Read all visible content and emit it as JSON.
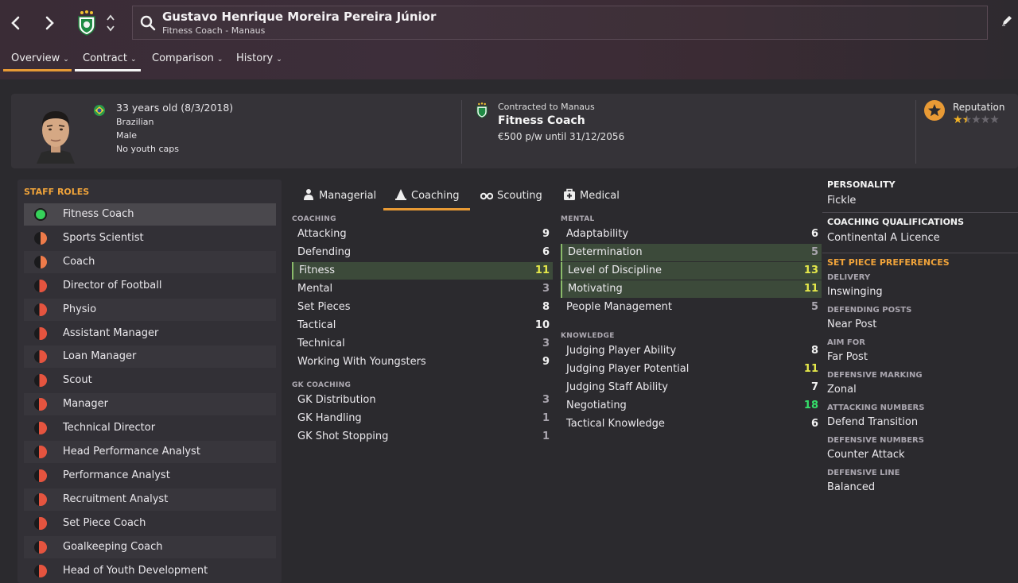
{
  "header": {
    "name": "Gustavo Henrique Moreira Pereira Júnior",
    "subtitle": "Fitness Coach - Manaus"
  },
  "tabs": [
    {
      "label": "Overview",
      "state": "active"
    },
    {
      "label": "Contract",
      "state": "underlined"
    },
    {
      "label": "Comparison",
      "state": ""
    },
    {
      "label": "History",
      "state": ""
    }
  ],
  "profile": {
    "age": "33 years old (8/3/2018)",
    "nationality": "Brazilian",
    "gender": "Male",
    "caps": "No youth caps"
  },
  "contract": {
    "contracted_to": "Contracted to Manaus",
    "role": "Fitness Coach",
    "wage": "€500 p/w until 31/12/2056"
  },
  "reputation": {
    "label": "Reputation",
    "stars": 1.5,
    "max_stars": 5
  },
  "staff_roles": {
    "title": "STAFF ROLES",
    "items": [
      {
        "label": "Fitness Coach",
        "suitability": 1.0
      },
      {
        "label": "Sports Scientist",
        "suitability": 0.5
      },
      {
        "label": "Coach",
        "suitability": 0.5
      },
      {
        "label": "Director of Football",
        "suitability": 0.3
      },
      {
        "label": "Physio",
        "suitability": 0.3
      },
      {
        "label": "Assistant Manager",
        "suitability": 0.3
      },
      {
        "label": "Loan Manager",
        "suitability": 0.3
      },
      {
        "label": "Scout",
        "suitability": 0.3
      },
      {
        "label": "Manager",
        "suitability": 0.2
      },
      {
        "label": "Technical Director",
        "suitability": 0.2
      },
      {
        "label": "Head Performance Analyst",
        "suitability": 0.2
      },
      {
        "label": "Performance Analyst",
        "suitability": 0.2
      },
      {
        "label": "Recruitment Analyst",
        "suitability": 0.2
      },
      {
        "label": "Set Piece Coach",
        "suitability": 0.2
      },
      {
        "label": "Goalkeeping Coach",
        "suitability": 0.2
      },
      {
        "label": "Head of Youth Development",
        "suitability": 0.2
      }
    ]
  },
  "attr_tabs": [
    {
      "label": "Managerial",
      "icon": "managerial-icon",
      "active": false
    },
    {
      "label": "Coaching",
      "icon": "coaching-icon",
      "active": true
    },
    {
      "label": "Scouting",
      "icon": "binoculars-icon",
      "active": false
    },
    {
      "label": "Medical",
      "icon": "medical-kit-icon",
      "active": false
    }
  ],
  "coaching": {
    "title": "COACHING",
    "items": [
      {
        "name": "Attacking",
        "value": "9",
        "hl": false
      },
      {
        "name": "Defending",
        "value": "6",
        "hl": false
      },
      {
        "name": "Fitness",
        "value": "11",
        "hl": true
      },
      {
        "name": "Mental",
        "value": "3",
        "hl": false
      },
      {
        "name": "Set Pieces",
        "value": "8",
        "hl": false
      },
      {
        "name": "Tactical",
        "value": "10",
        "hl": false
      },
      {
        "name": "Technical",
        "value": "3",
        "hl": false
      },
      {
        "name": "Working With Youngsters",
        "value": "9",
        "hl": false
      }
    ]
  },
  "gk_coaching": {
    "title": "GK COACHING",
    "items": [
      {
        "name": "GK Distribution",
        "value": "3",
        "hl": false
      },
      {
        "name": "GK Handling",
        "value": "1",
        "hl": false
      },
      {
        "name": "GK Shot Stopping",
        "value": "1",
        "hl": false
      }
    ]
  },
  "mental": {
    "title": "MENTAL",
    "items": [
      {
        "name": "Adaptability",
        "value": "6",
        "hl": false
      },
      {
        "name": "Determination",
        "value": "5",
        "hl": true
      },
      {
        "name": "Level of Discipline",
        "value": "13",
        "hl": true
      },
      {
        "name": "Motivating",
        "value": "11",
        "hl": true
      },
      {
        "name": "People Management",
        "value": "5",
        "hl": false
      }
    ]
  },
  "knowledge": {
    "title": "KNOWLEDGE",
    "items": [
      {
        "name": "Judging Player Ability",
        "value": "8",
        "hl": false
      },
      {
        "name": "Judging Player Potential",
        "value": "11",
        "hl": false
      },
      {
        "name": "Judging Staff Ability",
        "value": "7",
        "hl": false
      },
      {
        "name": "Negotiating",
        "value": "18",
        "hl": false
      },
      {
        "name": "Tactical Knowledge",
        "value": "6",
        "hl": false
      }
    ]
  },
  "personality": {
    "title": "PERSONALITY",
    "value": "Fickle"
  },
  "qualifications": {
    "title": "COACHING QUALIFICATIONS",
    "value": "Continental A Licence"
  },
  "set_piece": {
    "title": "SET PIECE PREFERENCES",
    "items": [
      {
        "label": "DELIVERY",
        "value": "Inswinging"
      },
      {
        "label": "DEFENDING POSTS",
        "value": "Near Post"
      },
      {
        "label": "AIM FOR",
        "value": "Far Post"
      },
      {
        "label": "DEFENSIVE MARKING",
        "value": "Zonal"
      },
      {
        "label": "ATTACKING NUMBERS",
        "value": "Defend Transition"
      },
      {
        "label": "DEFENSIVE NUMBERS",
        "value": "Counter Attack"
      },
      {
        "label": "DEFENSIVE LINE",
        "value": "Balanced"
      }
    ]
  },
  "colors": {
    "accent": "#e89a35",
    "rating_low": "#a9a5ae",
    "rating_mid": "#f3f3f3",
    "rating_good": "#e6e94a",
    "rating_great": "#35e06a",
    "role_green": "#36d25a",
    "role_orange": "#ee7b4a",
    "role_red": "#e5543f"
  }
}
